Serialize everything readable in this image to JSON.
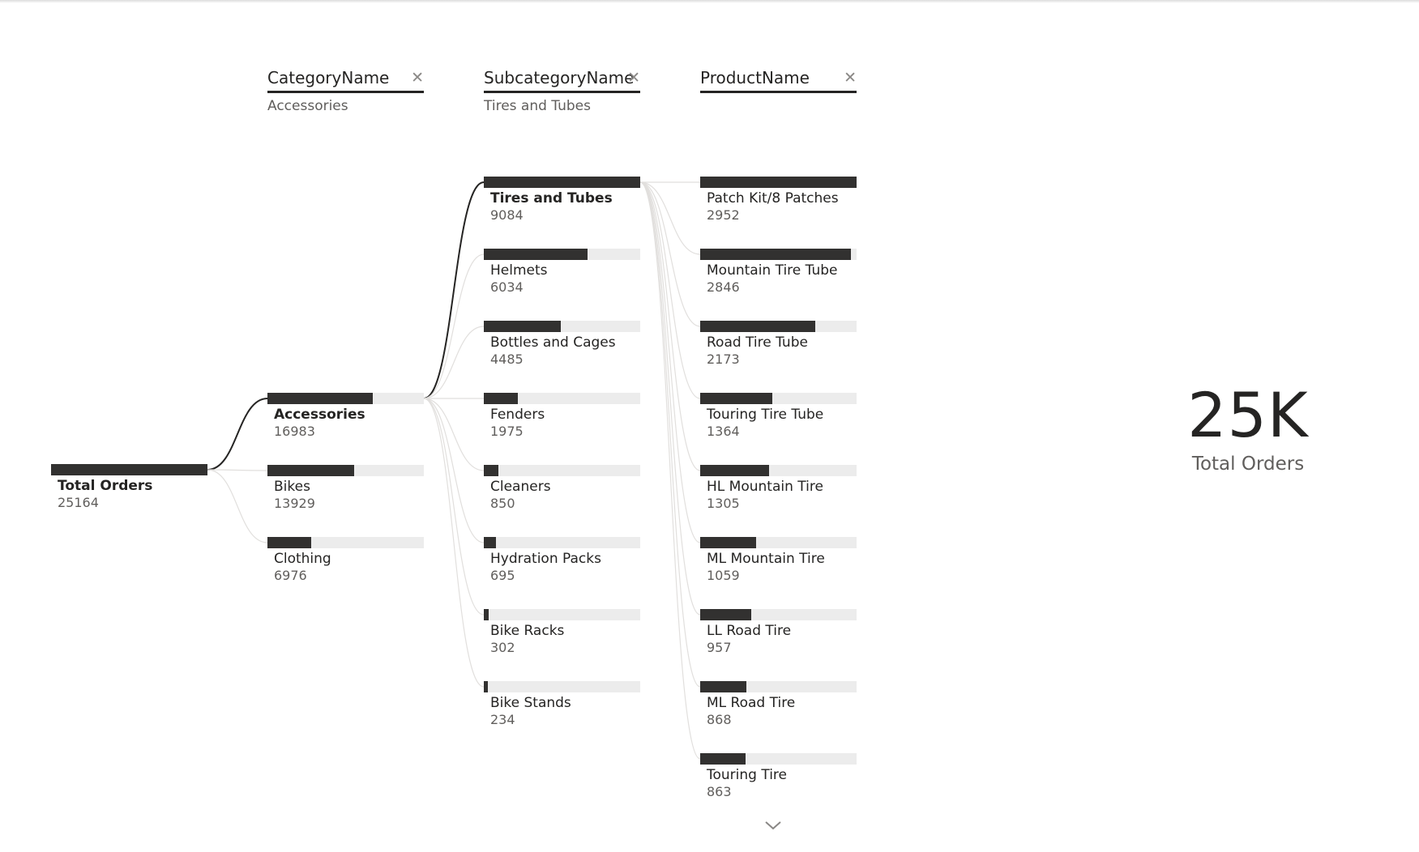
{
  "chart_data": {
    "type": "decomposition-tree",
    "root": {
      "label": "Total Orders",
      "value": 25164
    },
    "levels": [
      {
        "field": "CategoryName",
        "selected": "Accessories",
        "nodes": [
          {
            "label": "Accessories",
            "value": 16983
          },
          {
            "label": "Bikes",
            "value": 13929
          },
          {
            "label": "Clothing",
            "value": 6976
          }
        ]
      },
      {
        "field": "SubcategoryName",
        "selected": "Tires and Tubes",
        "nodes": [
          {
            "label": "Tires and Tubes",
            "value": 9084
          },
          {
            "label": "Helmets",
            "value": 6034
          },
          {
            "label": "Bottles and Cages",
            "value": 4485
          },
          {
            "label": "Fenders",
            "value": 1975
          },
          {
            "label": "Cleaners",
            "value": 850
          },
          {
            "label": "Hydration Packs",
            "value": 695
          },
          {
            "label": "Bike Racks",
            "value": 302
          },
          {
            "label": "Bike Stands",
            "value": 234
          }
        ]
      },
      {
        "field": "ProductName",
        "selected": "",
        "nodes": [
          {
            "label": "Patch Kit/8 Patches",
            "value": 2952
          },
          {
            "label": "Mountain Tire Tube",
            "value": 2846
          },
          {
            "label": "Road Tire Tube",
            "value": 2173
          },
          {
            "label": "Touring Tire Tube",
            "value": 1364
          },
          {
            "label": "HL Mountain Tire",
            "value": 1305
          },
          {
            "label": "ML Mountain Tire",
            "value": 1059
          },
          {
            "label": "LL Road Tire",
            "value": 957
          },
          {
            "label": "ML Road Tire",
            "value": 868
          },
          {
            "label": "Touring Tire",
            "value": 863
          }
        ]
      }
    ]
  },
  "card": {
    "value": "25K",
    "label": "Total Orders"
  },
  "icons": {
    "close": "close-icon",
    "expand": "chevron-down-icon"
  },
  "colors": {
    "bar": "#323130",
    "track": "#ececec",
    "active_link": "#252423",
    "inactive_link": "#e1dfdd"
  }
}
